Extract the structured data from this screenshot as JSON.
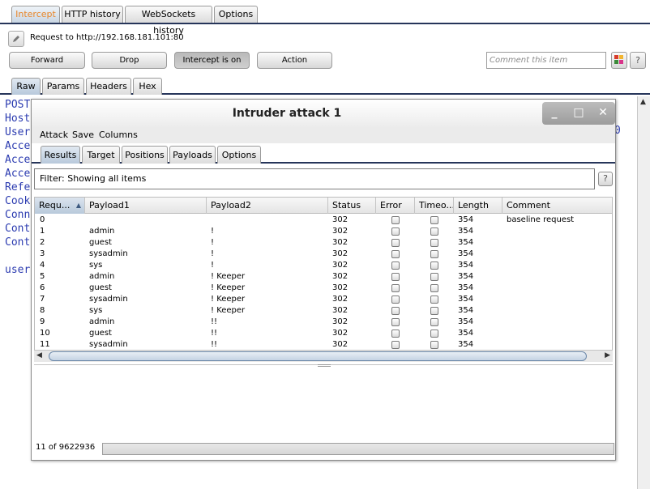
{
  "proxy_tabs": [
    "Intercept",
    "HTTP history",
    "WebSockets history",
    "Options"
  ],
  "request_label": "Request to http://192.168.181.101:80",
  "buttons": {
    "forward": "Forward",
    "drop": "Drop",
    "intercept": "Intercept is on",
    "action": "Action"
  },
  "comment_placeholder": "Comment this item",
  "help_glyph": "?",
  "message_tabs": [
    "Raw",
    "Params",
    "Headers",
    "Hex"
  ],
  "raw_lines": [
    "POST",
    "Host",
    "User",
    "Acce",
    "Acce",
    "Acce",
    "Refe",
    "Cook",
    "Conn",
    "Cont",
    "Cont",
    "",
    "user"
  ],
  "raw_right_fragment": "0",
  "intruder": {
    "title": "Intruder attack 1",
    "window_buttons": [
      "_",
      "□",
      "✕"
    ],
    "menu": [
      "Attack",
      "Save",
      "Columns"
    ],
    "tabs": [
      "Results",
      "Target",
      "Positions",
      "Payloads",
      "Options"
    ],
    "filter": "Filter:  Showing all items",
    "columns": [
      "Requ...",
      "Payload1",
      "Payload2",
      "Status",
      "Error",
      "Timeo...",
      "Length",
      "Comment"
    ],
    "rows": [
      {
        "req": "0",
        "p1": "",
        "p2": "",
        "status": "302",
        "length": "354",
        "comment": "baseline request"
      },
      {
        "req": "1",
        "p1": "admin",
        "p2": "!",
        "status": "302",
        "length": "354",
        "comment": ""
      },
      {
        "req": "2",
        "p1": "guest",
        "p2": "!",
        "status": "302",
        "length": "354",
        "comment": ""
      },
      {
        "req": "3",
        "p1": "sysadmin",
        "p2": "!",
        "status": "302",
        "length": "354",
        "comment": ""
      },
      {
        "req": "4",
        "p1": "sys",
        "p2": "!",
        "status": "302",
        "length": "354",
        "comment": ""
      },
      {
        "req": "5",
        "p1": "admin",
        "p2": "! Keeper",
        "status": "302",
        "length": "354",
        "comment": ""
      },
      {
        "req": "6",
        "p1": "guest",
        "p2": "! Keeper",
        "status": "302",
        "length": "354",
        "comment": ""
      },
      {
        "req": "7",
        "p1": "sysadmin",
        "p2": "! Keeper",
        "status": "302",
        "length": "354",
        "comment": ""
      },
      {
        "req": "8",
        "p1": "sys",
        "p2": "! Keeper",
        "status": "302",
        "length": "354",
        "comment": ""
      },
      {
        "req": "9",
        "p1": "admin",
        "p2": "!!",
        "status": "302",
        "length": "354",
        "comment": ""
      },
      {
        "req": "10",
        "p1": "guest",
        "p2": "!!",
        "status": "302",
        "length": "354",
        "comment": ""
      },
      {
        "req": "11",
        "p1": "sysadmin",
        "p2": "!!",
        "status": "302",
        "length": "354",
        "comment": ""
      }
    ],
    "status_text": "11 of 9622936"
  },
  "colors": {
    "accent_tab_text": "#e8862a",
    "raw_text": "#2b3bb0",
    "divider": "#26355a"
  }
}
